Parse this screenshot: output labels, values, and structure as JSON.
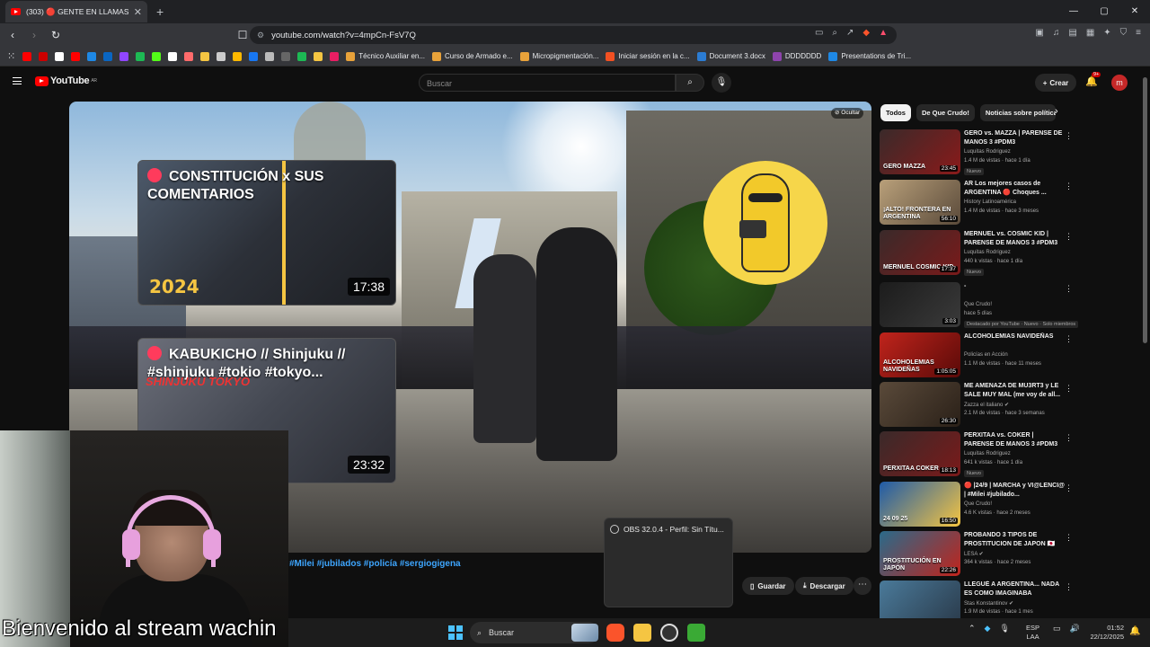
{
  "browser": {
    "tab_label": "(303) 🔴 GENTE EN LLAMAS",
    "tab_close": "✕",
    "new_tab": "+",
    "window_controls": [
      "—",
      "▢",
      "✕"
    ],
    "url": "youtube.com/watch?v=4mpCn-FsV7Q",
    "bookmarks": [
      {
        "label": "Técnico Auxiliar en...",
        "color": "#e8a23a"
      },
      {
        "label": "Curso de Armado e...",
        "color": "#e8a23a"
      },
      {
        "label": "Micropigmentación...",
        "color": "#e8a23a"
      },
      {
        "label": "Iniciar sesión en la c...",
        "color": "#f25022"
      },
      {
        "label": "Document 3.docx",
        "color": "#2b7cd3"
      },
      {
        "label": "DDDDDDD",
        "color": "#8e44ad"
      },
      {
        "label": "Presentations de Tri...",
        "color": "#1e88e5"
      }
    ],
    "bookmark_icon_colors": [
      "#ff0000",
      "#cc0000",
      "#ffffff",
      "#ff0000",
      "#1e88e5",
      "#0a66c2",
      "#9146ff",
      "#1db954",
      "#53fc18",
      "#ffffff",
      "#ff6b6b",
      "#f5c542",
      "#cccccc",
      "#ffb900",
      "#1877f2",
      "#bbbbbb",
      "#666666",
      "#1db954",
      "#f5c542",
      "#e91e63"
    ]
  },
  "youtube": {
    "logo": "YouTube",
    "logo_region": "AR",
    "search_placeholder": "Buscar",
    "create_label": "Crear",
    "notif_count": "9+",
    "avatar_letter": "m"
  },
  "player": {
    "hide_label": "Ocultar",
    "end_cards": [
      {
        "title": "CONSTITUCIÓN x SUS COMENTARIOS",
        "duration": "17:38",
        "overlay_text": "2024"
      },
      {
        "title": "KABUKICHO // Shinjuku // #shinjuku #tokio #tokyo...",
        "duration": "23:32",
        "overlay_text": "SHINJUKU TOKYO"
      }
    ]
  },
  "below_video": {
    "hashtags": "#Milei #jubilados #policía #sergiogigena",
    "save_label": "Guardar",
    "download_label": "Descargar",
    "more_label": "⋯"
  },
  "obs_popup": {
    "title": "OBS 32.0.4 - Perfil: Sin Títu..."
  },
  "webcam": {
    "caption": "Bienvenido al stream wachin"
  },
  "sidebar": {
    "chips": [
      "Todos",
      "De Que Crudo!",
      "Noticias sobre política"
    ],
    "recommendations": [
      {
        "title": "GERO vs. MAZZA | PARENSE DE MANOS 3 #PDM3",
        "channel": "Luquitas Rodriguez",
        "meta": "1.4 M de vistas · hace 1 día",
        "badge": "Nuevo",
        "duration": "23:45",
        "thumb_text": "GERO MAZZA",
        "color1": "#3a2a2a",
        "color2": "#8a1a1a"
      },
      {
        "title": "AR Los mejores casos de ARGENTINA 🔴 Choques ...",
        "channel": "History Latinoamérica",
        "meta": "1.4 M de vistas · hace 3 meses",
        "badge": "",
        "duration": "56:10",
        "thumb_text": "¡ALTO! FRONTERA EN ARGENTINA",
        "color1": "#b9a07a",
        "color2": "#5a4a3a"
      },
      {
        "title": "MERNUEL vs. COSMIC KID | PARENSE DE MANOS 3 #PDM3",
        "channel": "Luquitas Rodriguez",
        "meta": "440 k vistas · hace 1 día",
        "badge": "Nuevo",
        "duration": "17:37",
        "thumb_text": "MERNUEL COSMIC KID",
        "color1": "#3a2a2a",
        "color2": "#7a1a1a"
      },
      {
        "title": "-",
        "channel": "Que Crudo!",
        "meta": "hace 5 días",
        "badge": "Destacado por YouTube · Nuevo · Solo miembros",
        "duration": "3:03",
        "thumb_text": "",
        "color1": "#1c1c1c",
        "color2": "#3a3a3a"
      },
      {
        "title": "ALCOHOLEMIAS NAVIDEÑAS",
        "channel": "Policías en Acción",
        "meta": "1.1 M de vistas · hace 11 meses",
        "badge": "",
        "duration": "1:05:05",
        "thumb_text": "ALCOHOLEMIAS NAVIDEÑAS",
        "color1": "#c0241c",
        "color2": "#5a0a08"
      },
      {
        "title": "ME AMENAZA DE MU3RT3 y LE SALE MUY MAL (me voy de all...",
        "channel": "Zazza el italiano ✔",
        "meta": "2.1 M de vistas · hace 3 semanas",
        "badge": "",
        "duration": "26:30",
        "thumb_text": "",
        "color1": "#5a4a3a",
        "color2": "#2a2018"
      },
      {
        "title": "PERXITAA vs. COKER | PARENSE DE MANOS 3 #PDM3",
        "channel": "Luquitas Rodriguez",
        "meta": "641 k vistas · hace 1 día",
        "badge": "Nuevo",
        "duration": "18:13",
        "thumb_text": "PERXITAA COKER",
        "color1": "#3a2a2a",
        "color2": "#7a1a1a"
      },
      {
        "title": "🔴 |24/9 | MARCHA y VI@LENCI@ | #Milei #jubilado...",
        "channel": "Que Crudo!",
        "meta": "4.6 K vistas · hace 2 meses",
        "badge": "",
        "duration": "16:50",
        "thumb_text": "24 09 25",
        "color1": "#1e5aa8",
        "color2": "#f5c542"
      },
      {
        "title": "PROBANDO 3 TIPOS DE PROSTITUCION DE JAPON 🇯🇵",
        "channel": "LESA ✔",
        "meta": "364 k vistas · hace 2 meses",
        "badge": "",
        "duration": "22:26",
        "thumb_text": "PROSTITUCIÓN EN JAPÓN",
        "color1": "#2a6a8a",
        "color2": "#c0241c"
      },
      {
        "title": "LLEGUÉ A ARGENTINA... NADA ES COMO IMAGINABA",
        "channel": "Stas Konstantinov ✔",
        "meta": "1.9 M de vistas · hace 1 mes",
        "badge": "",
        "duration": "",
        "thumb_text": "",
        "color1": "#4a7a9a",
        "color2": "#2a3a4a"
      }
    ]
  },
  "taskbar": {
    "search_label": "Buscar",
    "lang_line1": "ESP",
    "lang_line2": "LAA",
    "time": "01:52",
    "date": "22/12/2025"
  }
}
